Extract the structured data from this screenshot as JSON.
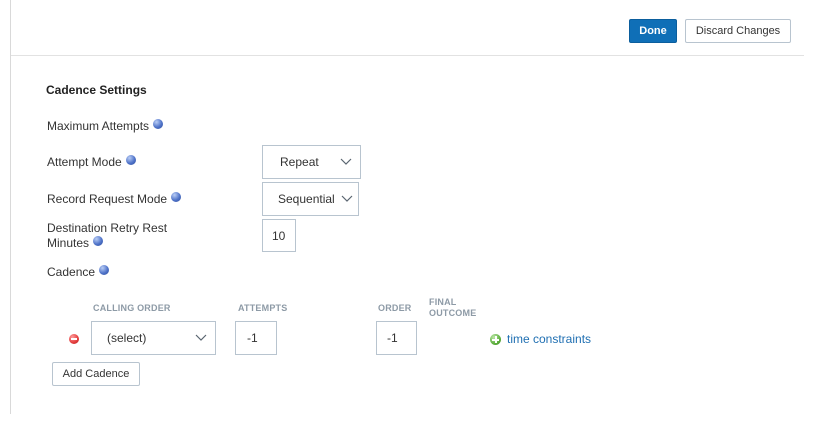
{
  "header": {
    "done_label": "Done",
    "discard_label": "Discard Changes"
  },
  "section": {
    "title": "Cadence Settings"
  },
  "fields": {
    "max_attempts_label": "Maximum Attempts",
    "attempt_mode_label": "Attempt Mode",
    "attempt_mode_value": "Repeat",
    "record_request_mode_label": "Record Request Mode",
    "record_request_mode_value": "Sequential",
    "retry_rest_label_line1": "Destination Retry Rest",
    "retry_rest_label_line2": "Minutes",
    "retry_rest_value": "10",
    "cadence_label": "Cadence"
  },
  "cadence_table": {
    "headers": {
      "calling_order": "CALLING ORDER",
      "attempts": "ATTEMPTS",
      "order": "ORDER",
      "final_outcome_line1": "FINAL",
      "final_outcome_line2": "OUTCOME"
    },
    "rows": [
      {
        "calling_order": "(select)",
        "attempts": "-1",
        "order": "-1",
        "time_constraints": "time constraints"
      }
    ],
    "add_label": "Add Cadence"
  },
  "icons": {
    "help": "help-icon",
    "remove": "remove-icon",
    "add": "add-icon",
    "chevron": "chevron-down-icon"
  },
  "colors": {
    "primary": "#0f6fb7",
    "link": "#1f6fb2",
    "remove": "#e23b3b",
    "add": "#5daf3d"
  }
}
